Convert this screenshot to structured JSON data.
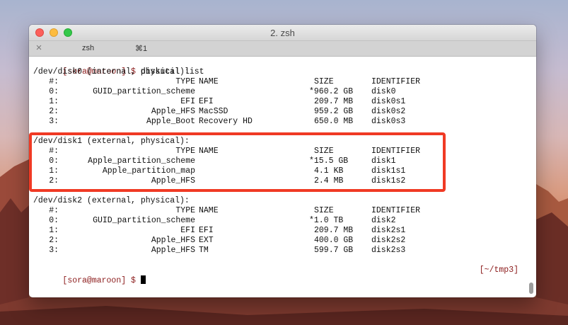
{
  "window": {
    "title": "2. zsh",
    "tab": {
      "close_glyph": "×",
      "title": "zsh",
      "shortcut": "⌘1"
    }
  },
  "terminal": {
    "command_prompt": "[sora@maroon] $",
    "command": "diskutil list",
    "end_prompt": "[sora@maroon] $",
    "cwd": "[~/tmp3]",
    "columns": {
      "num": "#:",
      "type": "TYPE",
      "name": "NAME",
      "size": "SIZE",
      "identifier": "IDENTIFIER"
    },
    "disks": [
      {
        "header": "/dev/disk0 (internal, physical):",
        "partitions": [
          {
            "num": "0:",
            "type": "GUID_partition_scheme",
            "name": "",
            "size": "*960.2 GB",
            "identifier": "disk0"
          },
          {
            "num": "1:",
            "type": "EFI",
            "name": "EFI",
            "size": "209.7 MB",
            "identifier": "disk0s1"
          },
          {
            "num": "2:",
            "type": "Apple_HFS",
            "name": "MacSSD",
            "size": "959.2 GB",
            "identifier": "disk0s2"
          },
          {
            "num": "3:",
            "type": "Apple_Boot",
            "name": "Recovery HD",
            "size": "650.0 MB",
            "identifier": "disk0s3"
          }
        ]
      },
      {
        "header": "/dev/disk1 (external, physical):",
        "partitions": [
          {
            "num": "0:",
            "type": "Apple_partition_scheme",
            "name": "",
            "size": "*15.5 GB",
            "identifier": "disk1"
          },
          {
            "num": "1:",
            "type": "Apple_partition_map",
            "name": "",
            "size": "4.1 KB",
            "identifier": "disk1s1"
          },
          {
            "num": "2:",
            "type": "Apple_HFS",
            "name": "",
            "size": "2.4 MB",
            "identifier": "disk1s2"
          }
        ]
      },
      {
        "header": "/dev/disk2 (external, physical):",
        "partitions": [
          {
            "num": "0:",
            "type": "GUID_partition_scheme",
            "name": "",
            "size": "*1.0 TB",
            "identifier": "disk2"
          },
          {
            "num": "1:",
            "type": "EFI",
            "name": "EFI",
            "size": "209.7 MB",
            "identifier": "disk2s1"
          },
          {
            "num": "2:",
            "type": "Apple_HFS",
            "name": "EXT",
            "size": "400.0 GB",
            "identifier": "disk2s2"
          },
          {
            "num": "3:",
            "type": "Apple_HFS",
            "name": "TM",
            "size": "599.7 GB",
            "identifier": "disk2s3"
          }
        ]
      }
    ]
  },
  "colors": {
    "highlight_border": "#f03a24",
    "prompt": "#8b1a1a"
  }
}
